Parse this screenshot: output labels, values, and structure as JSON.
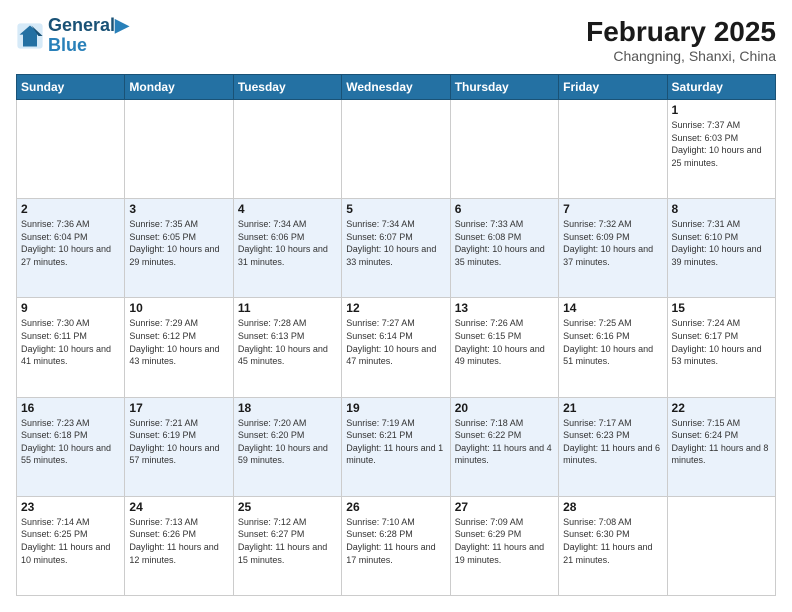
{
  "header": {
    "logo_line1": "General",
    "logo_line2": "Blue",
    "main_title": "February 2025",
    "subtitle": "Changning, Shanxi, China"
  },
  "days_of_week": [
    "Sunday",
    "Monday",
    "Tuesday",
    "Wednesday",
    "Thursday",
    "Friday",
    "Saturday"
  ],
  "weeks": [
    {
      "shaded": false,
      "days": [
        {
          "num": "",
          "info": ""
        },
        {
          "num": "",
          "info": ""
        },
        {
          "num": "",
          "info": ""
        },
        {
          "num": "",
          "info": ""
        },
        {
          "num": "",
          "info": ""
        },
        {
          "num": "",
          "info": ""
        },
        {
          "num": "1",
          "info": "Sunrise: 7:37 AM\nSunset: 6:03 PM\nDaylight: 10 hours and 25 minutes."
        }
      ]
    },
    {
      "shaded": true,
      "days": [
        {
          "num": "2",
          "info": "Sunrise: 7:36 AM\nSunset: 6:04 PM\nDaylight: 10 hours and 27 minutes."
        },
        {
          "num": "3",
          "info": "Sunrise: 7:35 AM\nSunset: 6:05 PM\nDaylight: 10 hours and 29 minutes."
        },
        {
          "num": "4",
          "info": "Sunrise: 7:34 AM\nSunset: 6:06 PM\nDaylight: 10 hours and 31 minutes."
        },
        {
          "num": "5",
          "info": "Sunrise: 7:34 AM\nSunset: 6:07 PM\nDaylight: 10 hours and 33 minutes."
        },
        {
          "num": "6",
          "info": "Sunrise: 7:33 AM\nSunset: 6:08 PM\nDaylight: 10 hours and 35 minutes."
        },
        {
          "num": "7",
          "info": "Sunrise: 7:32 AM\nSunset: 6:09 PM\nDaylight: 10 hours and 37 minutes."
        },
        {
          "num": "8",
          "info": "Sunrise: 7:31 AM\nSunset: 6:10 PM\nDaylight: 10 hours and 39 minutes."
        }
      ]
    },
    {
      "shaded": false,
      "days": [
        {
          "num": "9",
          "info": "Sunrise: 7:30 AM\nSunset: 6:11 PM\nDaylight: 10 hours and 41 minutes."
        },
        {
          "num": "10",
          "info": "Sunrise: 7:29 AM\nSunset: 6:12 PM\nDaylight: 10 hours and 43 minutes."
        },
        {
          "num": "11",
          "info": "Sunrise: 7:28 AM\nSunset: 6:13 PM\nDaylight: 10 hours and 45 minutes."
        },
        {
          "num": "12",
          "info": "Sunrise: 7:27 AM\nSunset: 6:14 PM\nDaylight: 10 hours and 47 minutes."
        },
        {
          "num": "13",
          "info": "Sunrise: 7:26 AM\nSunset: 6:15 PM\nDaylight: 10 hours and 49 minutes."
        },
        {
          "num": "14",
          "info": "Sunrise: 7:25 AM\nSunset: 6:16 PM\nDaylight: 10 hours and 51 minutes."
        },
        {
          "num": "15",
          "info": "Sunrise: 7:24 AM\nSunset: 6:17 PM\nDaylight: 10 hours and 53 minutes."
        }
      ]
    },
    {
      "shaded": true,
      "days": [
        {
          "num": "16",
          "info": "Sunrise: 7:23 AM\nSunset: 6:18 PM\nDaylight: 10 hours and 55 minutes."
        },
        {
          "num": "17",
          "info": "Sunrise: 7:21 AM\nSunset: 6:19 PM\nDaylight: 10 hours and 57 minutes."
        },
        {
          "num": "18",
          "info": "Sunrise: 7:20 AM\nSunset: 6:20 PM\nDaylight: 10 hours and 59 minutes."
        },
        {
          "num": "19",
          "info": "Sunrise: 7:19 AM\nSunset: 6:21 PM\nDaylight: 11 hours and 1 minute."
        },
        {
          "num": "20",
          "info": "Sunrise: 7:18 AM\nSunset: 6:22 PM\nDaylight: 11 hours and 4 minutes."
        },
        {
          "num": "21",
          "info": "Sunrise: 7:17 AM\nSunset: 6:23 PM\nDaylight: 11 hours and 6 minutes."
        },
        {
          "num": "22",
          "info": "Sunrise: 7:15 AM\nSunset: 6:24 PM\nDaylight: 11 hours and 8 minutes."
        }
      ]
    },
    {
      "shaded": false,
      "days": [
        {
          "num": "23",
          "info": "Sunrise: 7:14 AM\nSunset: 6:25 PM\nDaylight: 11 hours and 10 minutes."
        },
        {
          "num": "24",
          "info": "Sunrise: 7:13 AM\nSunset: 6:26 PM\nDaylight: 11 hours and 12 minutes."
        },
        {
          "num": "25",
          "info": "Sunrise: 7:12 AM\nSunset: 6:27 PM\nDaylight: 11 hours and 15 minutes."
        },
        {
          "num": "26",
          "info": "Sunrise: 7:10 AM\nSunset: 6:28 PM\nDaylight: 11 hours and 17 minutes."
        },
        {
          "num": "27",
          "info": "Sunrise: 7:09 AM\nSunset: 6:29 PM\nDaylight: 11 hours and 19 minutes."
        },
        {
          "num": "28",
          "info": "Sunrise: 7:08 AM\nSunset: 6:30 PM\nDaylight: 11 hours and 21 minutes."
        },
        {
          "num": "",
          "info": ""
        }
      ]
    }
  ]
}
